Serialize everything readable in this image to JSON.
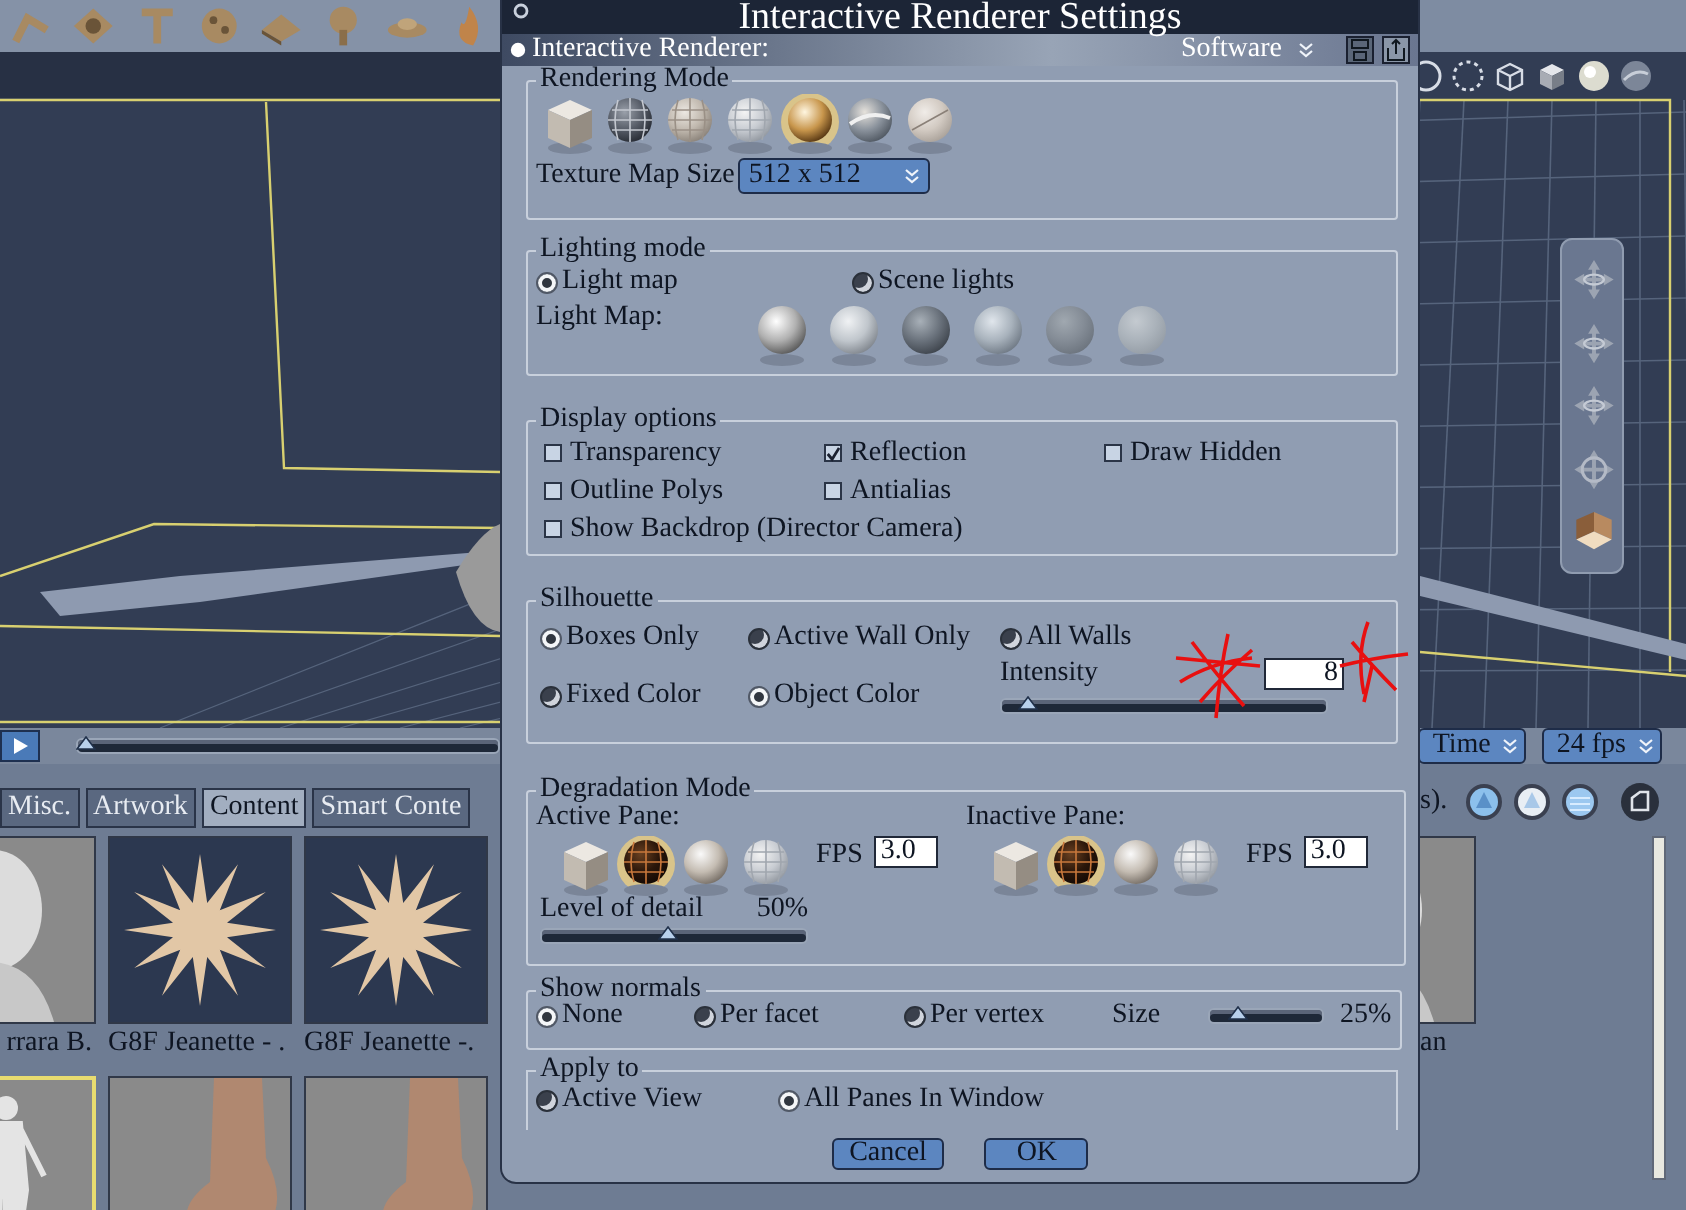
{
  "app": {
    "library_tabs": [
      {
        "label": "Misc.",
        "selected": false
      },
      {
        "label": "Artwork",
        "selected": false
      },
      {
        "label": "Content",
        "selected": true
      },
      {
        "label": "Smart Conte",
        "selected": false
      }
    ],
    "thumbnails": [
      {
        "caption": "rrara B.",
        "kind": "head",
        "selected": false
      },
      {
        "caption": "G8F Jeanette - .",
        "kind": "star",
        "selected": false
      },
      {
        "caption": "G8F Jeanette -.",
        "kind": "star",
        "selected": false
      },
      {
        "kind": "figure",
        "selected": true
      },
      {
        "kind": "foot",
        "selected": false
      },
      {
        "kind": "foot",
        "selected": false
      }
    ],
    "right_thumbnail": {
      "caption": "an",
      "kind": "head"
    },
    "library_note": "s).",
    "timeline": {
      "level": 0.02
    },
    "time_mode": "Time",
    "frame_rate": "24 fps"
  },
  "dialog": {
    "title": "Interactive Renderer Settings",
    "renderer_label": "Interactive Renderer:",
    "renderer_value": "Software",
    "rendering_mode": {
      "legend": "Rendering Mode",
      "modes": [
        {
          "kind": "box",
          "selected": false
        },
        {
          "kind": "wireframe",
          "selected": false
        },
        {
          "kind": "hidden-line",
          "selected": false
        },
        {
          "kind": "lit-wireframe",
          "selected": false
        },
        {
          "kind": "smooth",
          "selected": true
        },
        {
          "kind": "texture",
          "selected": false
        },
        {
          "kind": "flat",
          "selected": false
        }
      ],
      "texture_label": "Texture Map Size",
      "texture_size": "512 x  512"
    },
    "lighting_mode": {
      "legend": "Lighting mode",
      "options": [
        {
          "label": "Light map",
          "selected": true
        },
        {
          "label": "Scene lights",
          "selected": false
        }
      ],
      "light_map_label": "Light Map:"
    },
    "display_options": {
      "legend": "Display options",
      "options": [
        {
          "label": "Transparency",
          "checked": false
        },
        {
          "label": "Reflection",
          "checked": true
        },
        {
          "label": "Draw Hidden",
          "checked": false
        },
        {
          "label": "Outline Polys",
          "checked": false
        },
        {
          "label": "Antialias",
          "checked": false
        },
        {
          "label": "Show Backdrop (Director Camera)",
          "checked": false
        }
      ]
    },
    "silhouette": {
      "legend": "Silhouette",
      "walls": [
        {
          "label": "Boxes Only",
          "selected": true
        },
        {
          "label": "Active Wall Only",
          "selected": false
        },
        {
          "label": "All Walls",
          "selected": false
        }
      ],
      "colors": [
        {
          "label": "Fixed Color",
          "selected": false
        },
        {
          "label": "Object Color",
          "selected": true
        }
      ],
      "intensity_label": "Intensity",
      "intensity_value": "8",
      "intensity": {
        "level": 0.08
      }
    },
    "degradation": {
      "legend": "Degradation Mode",
      "panes": [
        {
          "label": "Active Pane:",
          "modes": [
            {
              "kind": "box",
              "selected": false
            },
            {
              "kind": "texture",
              "selected": true
            },
            {
              "kind": "smooth",
              "selected": false
            },
            {
              "kind": "lit-wireframe",
              "selected": false
            }
          ],
          "fps_label": "FPS",
          "fps": "3.0"
        },
        {
          "label": "Inactive Pane:",
          "modes": [
            {
              "kind": "box",
              "selected": false
            },
            {
              "kind": "texture",
              "selected": true
            },
            {
              "kind": "smooth",
              "selected": false
            },
            {
              "kind": "lit-wireframe",
              "selected": false
            }
          ],
          "fps_label": "FPS",
          "fps": "3.0"
        }
      ],
      "detail_label": "Level of detail",
      "detail_value": "50%",
      "detail": {
        "level": 0.48
      }
    },
    "normals": {
      "legend": "Show normals",
      "options": [
        {
          "label": "None",
          "selected": true
        },
        {
          "label": "Per facet",
          "selected": false
        },
        {
          "label": "Per vertex",
          "selected": false
        }
      ],
      "size_label": "Size",
      "size_value": "25%",
      "size": {
        "level": 0.25
      }
    },
    "apply_to": {
      "legend": "Apply to",
      "options": [
        {
          "label": "Active View",
          "selected": false
        },
        {
          "label": "All Panes In Window",
          "selected": true
        }
      ]
    },
    "buttons": [
      "Cancel",
      "OK"
    ]
  }
}
